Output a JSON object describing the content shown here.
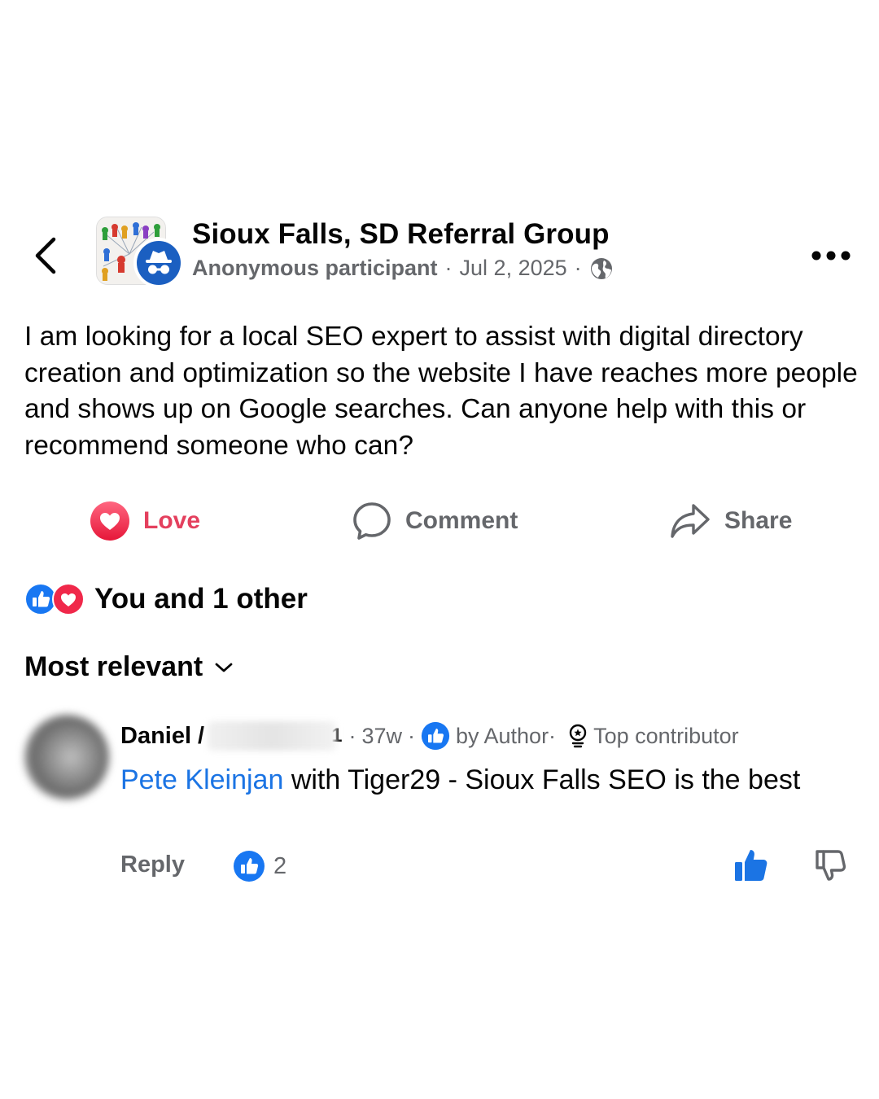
{
  "header": {
    "group_name": "Sioux Falls, SD Referral Group",
    "author": "Anonymous participant",
    "date": "Jul 2, 2025",
    "separator": "·",
    "privacy_icon": "globe-icon"
  },
  "post": {
    "text": "I am looking for a local SEO expert to assist with digital directory creation and optimization so the website I have reaches more people and shows up on Google searches. Can anyone help with this or recommend someone who can?"
  },
  "actions": {
    "love": "Love",
    "comment": "Comment",
    "share": "Share"
  },
  "reactions": {
    "summary": "You and 1 other"
  },
  "sort": {
    "label": "Most relevant"
  },
  "comment": {
    "author_first": "Daniel",
    "author_fragment": "/",
    "author_end": "1",
    "time": "37w",
    "liked_by": "by Author·",
    "badge": "Top contributor",
    "mention": "Pete Kleinjan",
    "text": " with Tiger29 - Sioux Falls SEO is the best",
    "reply": "Reply",
    "like_count": "2"
  },
  "colors": {
    "love": "#e4405e",
    "blue": "#1b74e4",
    "meta": "#65676b",
    "like_blue": "#1877f2"
  }
}
